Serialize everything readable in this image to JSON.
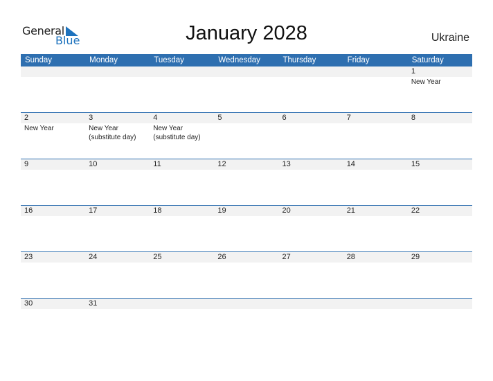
{
  "logo": {
    "line1": "General",
    "line2": "Blue"
  },
  "title": "January 2028",
  "country": "Ukraine",
  "days": [
    "Sunday",
    "Monday",
    "Tuesday",
    "Wednesday",
    "Thursday",
    "Friday",
    "Saturday"
  ],
  "weeks": [
    [
      {
        "d": "",
        "h": ""
      },
      {
        "d": "",
        "h": ""
      },
      {
        "d": "",
        "h": ""
      },
      {
        "d": "",
        "h": ""
      },
      {
        "d": "",
        "h": ""
      },
      {
        "d": "",
        "h": ""
      },
      {
        "d": "1",
        "h": "New Year"
      }
    ],
    [
      {
        "d": "2",
        "h": "New Year"
      },
      {
        "d": "3",
        "h": "New Year (substitute day)"
      },
      {
        "d": "4",
        "h": "New Year (substitute day)"
      },
      {
        "d": "5",
        "h": ""
      },
      {
        "d": "6",
        "h": ""
      },
      {
        "d": "7",
        "h": ""
      },
      {
        "d": "8",
        "h": ""
      }
    ],
    [
      {
        "d": "9",
        "h": ""
      },
      {
        "d": "10",
        "h": ""
      },
      {
        "d": "11",
        "h": ""
      },
      {
        "d": "12",
        "h": ""
      },
      {
        "d": "13",
        "h": ""
      },
      {
        "d": "14",
        "h": ""
      },
      {
        "d": "15",
        "h": ""
      }
    ],
    [
      {
        "d": "16",
        "h": ""
      },
      {
        "d": "17",
        "h": ""
      },
      {
        "d": "18",
        "h": ""
      },
      {
        "d": "19",
        "h": ""
      },
      {
        "d": "20",
        "h": ""
      },
      {
        "d": "21",
        "h": ""
      },
      {
        "d": "22",
        "h": ""
      }
    ],
    [
      {
        "d": "23",
        "h": ""
      },
      {
        "d": "24",
        "h": ""
      },
      {
        "d": "25",
        "h": ""
      },
      {
        "d": "26",
        "h": ""
      },
      {
        "d": "27",
        "h": ""
      },
      {
        "d": "28",
        "h": ""
      },
      {
        "d": "29",
        "h": ""
      }
    ],
    [
      {
        "d": "30",
        "h": ""
      },
      {
        "d": "31",
        "h": ""
      },
      {
        "d": "",
        "h": ""
      },
      {
        "d": "",
        "h": ""
      },
      {
        "d": "",
        "h": ""
      },
      {
        "d": "",
        "h": ""
      },
      {
        "d": "",
        "h": ""
      }
    ]
  ],
  "colors": {
    "header": "#2e6fb0",
    "strip": "#f2f2f2",
    "logo_blue": "#1e73be"
  }
}
